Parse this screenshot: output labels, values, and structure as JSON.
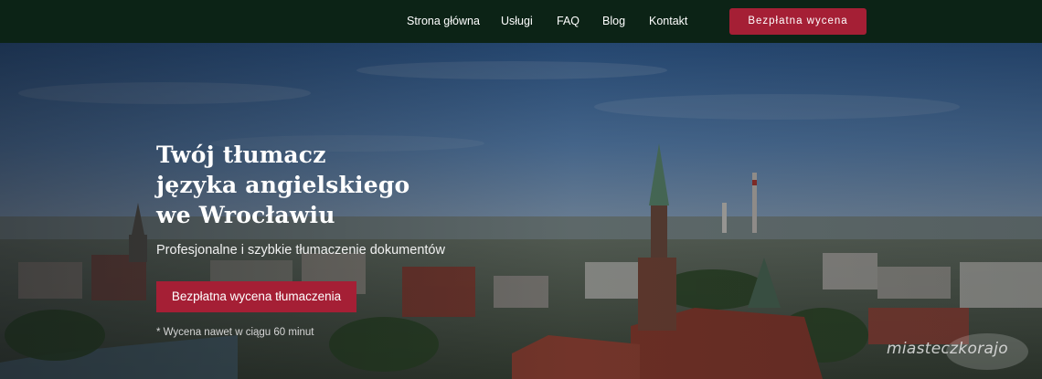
{
  "nav": {
    "links": [
      "Strona główna",
      "Usługi",
      "FAQ",
      "Blog",
      "Kontakt"
    ],
    "cta": "Bezpłatna wycena"
  },
  "hero": {
    "title_lines": [
      "Twój tłumacz",
      "języka angielskiego",
      "we Wrocławiu"
    ],
    "subtitle": "Profesjonalne i szybkie tłumaczenie dokumentów",
    "cta": "Bezpłatna wycena tłumaczenia",
    "note": "* Wycena nawet w ciągu 60 minut",
    "background": "wroclaw-aerial-cityscape"
  },
  "watermark": "miasteczkorajo",
  "colors": {
    "nav_bg": "#0c2316",
    "accent": "#a51f35",
    "text": "#ffffff"
  }
}
